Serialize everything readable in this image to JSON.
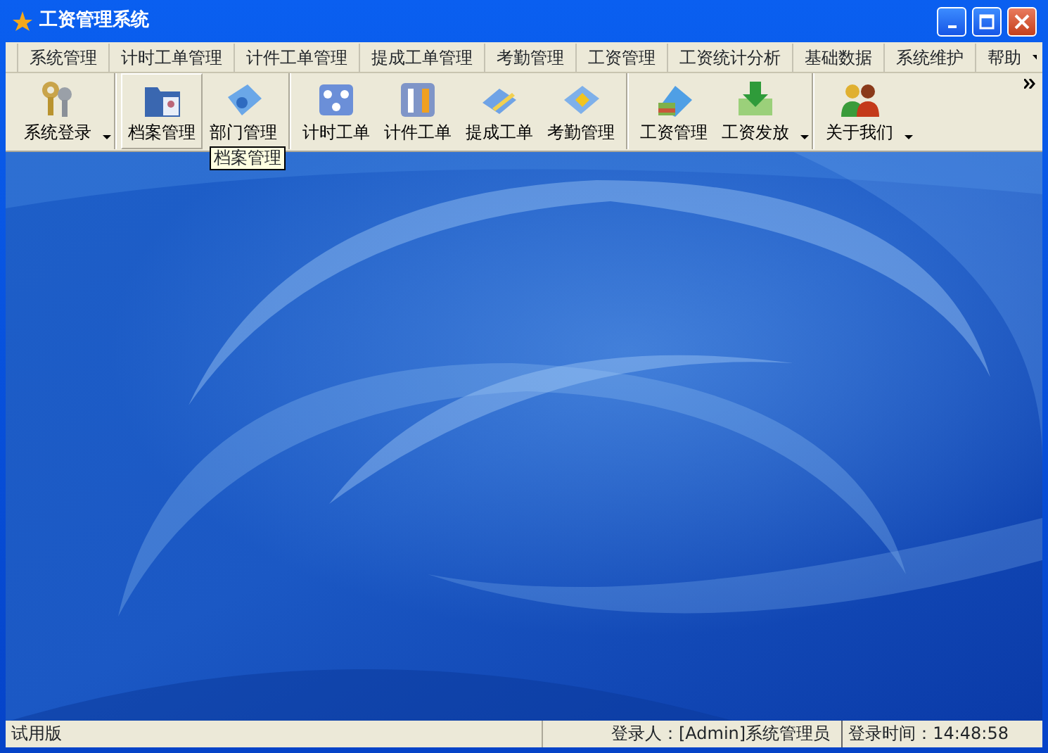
{
  "window": {
    "title": "工资管理系统"
  },
  "menu": [
    {
      "label": "系统管理"
    },
    {
      "label": "计时工单管理"
    },
    {
      "label": "计件工单管理"
    },
    {
      "label": "提成工单管理"
    },
    {
      "label": "考勤管理"
    },
    {
      "label": "工资管理"
    },
    {
      "label": "工资统计分析"
    },
    {
      "label": "基础数据"
    },
    {
      "label": "系统维护"
    },
    {
      "label": "帮助"
    }
  ],
  "toolbar": [
    [
      {
        "label": "系统登录",
        "dropdown": true,
        "hovered": false
      }
    ],
    [
      {
        "label": "档案管理",
        "dropdown": false,
        "hovered": true
      },
      {
        "label": "部门管理",
        "dropdown": false,
        "hovered": false
      }
    ],
    [
      {
        "label": "计时工单",
        "dropdown": false,
        "hovered": false
      },
      {
        "label": "计件工单",
        "dropdown": false,
        "hovered": false
      },
      {
        "label": "提成工单",
        "dropdown": false,
        "hovered": false
      },
      {
        "label": "考勤管理",
        "dropdown": false,
        "hovered": false
      }
    ],
    [
      {
        "label": "工资管理",
        "dropdown": false,
        "hovered": false
      },
      {
        "label": "工资发放",
        "dropdown": true,
        "hovered": false
      }
    ],
    [
      {
        "label": "关于我们",
        "dropdown": true,
        "hovered": false
      }
    ]
  ],
  "tooltip": {
    "text": "档案管理"
  },
  "status_bar": {
    "edition": "试用版",
    "user": "登录人：[Admin]系统管理员",
    "login_time": "登录时间：14:48:58"
  }
}
